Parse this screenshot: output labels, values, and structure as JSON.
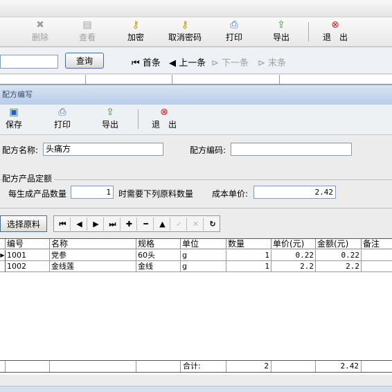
{
  "main_toolbar": {
    "delete": {
      "label": "删除",
      "icon": "delete-x-icon"
    },
    "view": {
      "label": "查看",
      "icon": "view-doc-icon"
    },
    "encrypt": {
      "label": "加密",
      "icon": "key-icon"
    },
    "decrypt": {
      "label": "取消密码",
      "icon": "keys-icon"
    },
    "print": {
      "label": "打印",
      "icon": "printer-icon"
    },
    "export": {
      "label": "导出",
      "icon": "export-icon"
    },
    "exit": {
      "label": "退　出",
      "icon": "exit-icon"
    }
  },
  "search_bar": {
    "query_label": "查询",
    "nav_first": "首条",
    "nav_prev": "上一条",
    "nav_next": "下一条",
    "nav_last": "末条"
  },
  "dialog": {
    "title": "配方编写",
    "toolbar": {
      "save": "保存",
      "print": "打印",
      "export": "导出",
      "exit": "退　出"
    },
    "formula_name_label": "配方名称:",
    "formula_name_value": "头痛方",
    "formula_code_label": "配方编码:",
    "formula_code_value": "",
    "group_title": "配方产品定额",
    "qty_label": "每生成产品数量",
    "qty_value": "1",
    "qty_suffix": "时需要下列原料数量",
    "unit_cost_label": "成本单价:",
    "unit_cost_value": "2.42",
    "select_material_label": "选择原料"
  },
  "grid": {
    "columns": [
      "编号",
      "名称",
      "规格",
      "单位",
      "数量",
      "单价(元)",
      "金额(元)",
      "备注"
    ],
    "rows": [
      {
        "code": "1001",
        "name": "党参",
        "spec": "60头",
        "unit": "g",
        "qty": "1",
        "price": "0.22",
        "amount": "0.22",
        "note": ""
      },
      {
        "code": "1002",
        "name": "金线莲",
        "spec": "金线",
        "unit": "g",
        "qty": "1",
        "price": "2.2",
        "amount": "2.2",
        "note": ""
      }
    ],
    "footer": {
      "label": "合计:",
      "qty_total": "2",
      "amount_total": "2.42"
    }
  },
  "colors": {
    "accent_blue": "#b9cde8",
    "exit_red": "#d81e1e",
    "save_blue": "#1f5fbf"
  }
}
